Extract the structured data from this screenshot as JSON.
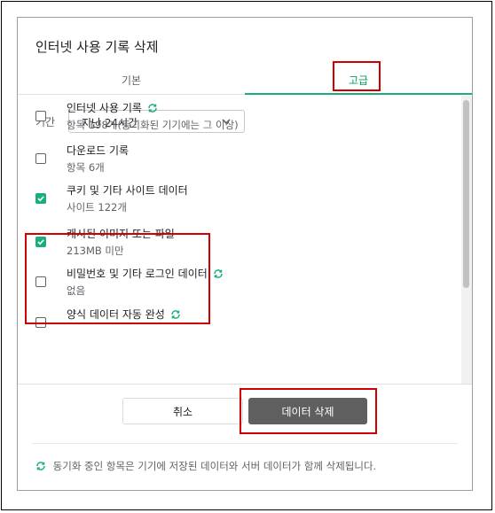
{
  "dialog": {
    "title": "인터넷 사용 기록 삭제",
    "tabs": [
      {
        "label": "기본"
      },
      {
        "label": "고급"
      }
    ]
  },
  "time_range": {
    "label": "기간",
    "selected": "지난 24시간"
  },
  "items": [
    {
      "title": "인터넷 사용 기록",
      "desc": "항목 198개(동기화된 기기에는 그 이상)",
      "checked": false,
      "synced": true
    },
    {
      "title": "다운로드 기록",
      "desc": "항목 6개",
      "checked": false,
      "synced": false
    },
    {
      "title": "쿠키 및 기타 사이트 데이터",
      "desc": "사이트 122개",
      "checked": true,
      "synced": false
    },
    {
      "title": "캐시된 이미지 또는 파일",
      "desc": "213MB 미만",
      "checked": true,
      "synced": false
    },
    {
      "title": "비밀번호 및 기타 로그인 데이터",
      "desc": "없음",
      "checked": false,
      "synced": true
    },
    {
      "title": "양식 데이터 자동 완성",
      "desc": "",
      "checked": false,
      "synced": true
    }
  ],
  "buttons": {
    "cancel": "취소",
    "delete": "데이터 삭제"
  },
  "footer": {
    "text": "동기화 중인 항목은 기기에 저장된 데이터와 서버 데이터가 함께 삭제됩니다."
  },
  "colors": {
    "accent": "#1aae7f",
    "delete_button": "#5f5f5f",
    "highlight": "#d00000"
  },
  "icons": {
    "sync": "sync-icon",
    "dropdown": "chevron-down-icon",
    "checkmark": "checkmark-icon"
  }
}
